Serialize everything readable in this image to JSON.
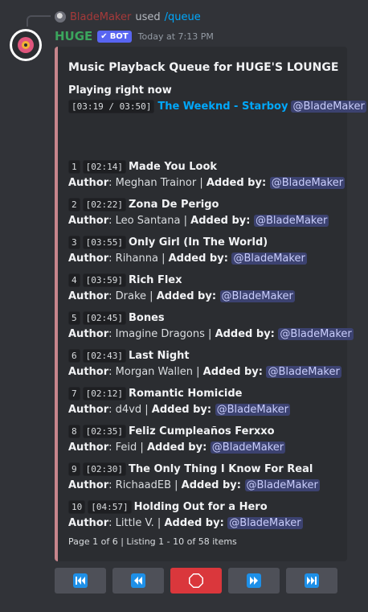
{
  "reply": {
    "username": "BladeMaker",
    "used_text": "used",
    "command": "/queue"
  },
  "message": {
    "username": "HUGE",
    "bot_tag": "BOT",
    "timestamp": "Today at 7:13 PM"
  },
  "embed": {
    "title": "Music Playback Queue for HUGE'S LOUNGE",
    "playing_label": "Playing right now",
    "now_playing": {
      "time": "[03:19 / 03:50]",
      "track": "The Weeknd - Starboy",
      "added_by": "@BladeMaker"
    },
    "author_label": "Author",
    "added_by_label": "Added by",
    "queue": [
      {
        "index": "1",
        "duration": "[02:14]",
        "title": "Made You Look",
        "author": "Meghan Trainor",
        "added_by": "@BladeMaker"
      },
      {
        "index": "2",
        "duration": "[02:22]",
        "title": "Zona De Perigo",
        "author": "Leo Santana",
        "added_by": "@BladeMaker"
      },
      {
        "index": "3",
        "duration": "[03:55]",
        "title": "Only Girl (In The World)",
        "author": "Rihanna",
        "added_by": "@BladeMaker"
      },
      {
        "index": "4",
        "duration": "[03:59]",
        "title": "Rich Flex",
        "author": "Drake",
        "added_by": "@BladeMaker"
      },
      {
        "index": "5",
        "duration": "[02:45]",
        "title": "Bones",
        "author": "Imagine Dragons",
        "added_by": "@BladeMaker"
      },
      {
        "index": "6",
        "duration": "[02:43]",
        "title": "Last Night",
        "author": "Morgan Wallen",
        "added_by": "@BladeMaker"
      },
      {
        "index": "7",
        "duration": "[02:12]",
        "title": "Romantic Homicide",
        "author": "d4vd",
        "added_by": "@BladeMaker"
      },
      {
        "index": "8",
        "duration": "[02:35]",
        "title": "Feliz Cumpleaños Ferxxo",
        "author": "Feid",
        "added_by": "@BladeMaker"
      },
      {
        "index": "9",
        "duration": "[02:30]",
        "title": "The Only Thing I Know For Real",
        "author": "RichaadEB",
        "added_by": "@BladeMaker"
      },
      {
        "index": "10",
        "duration": "[04:57]",
        "title": "Holding Out for a Hero",
        "author": "Little V.",
        "added_by": "@BladeMaker"
      }
    ],
    "footer": "Page 1 of 6 | Listing 1 - 10 of 58 items"
  },
  "controls": [
    {
      "icon": "first-page-icon"
    },
    {
      "icon": "previous-page-icon"
    },
    {
      "icon": "stop-icon"
    },
    {
      "icon": "next-page-icon"
    },
    {
      "icon": "last-page-icon"
    }
  ],
  "colors": {
    "background": "#313338",
    "embed_background": "#2b2d31",
    "embed_border": "#c7858c",
    "bot_username": "#3ba55d",
    "link": "#00a8fc",
    "mention_bg": "#3c4270",
    "danger_button": "#da373c",
    "secondary_button": "#4e5058",
    "button_icon": "#1e90e8"
  }
}
